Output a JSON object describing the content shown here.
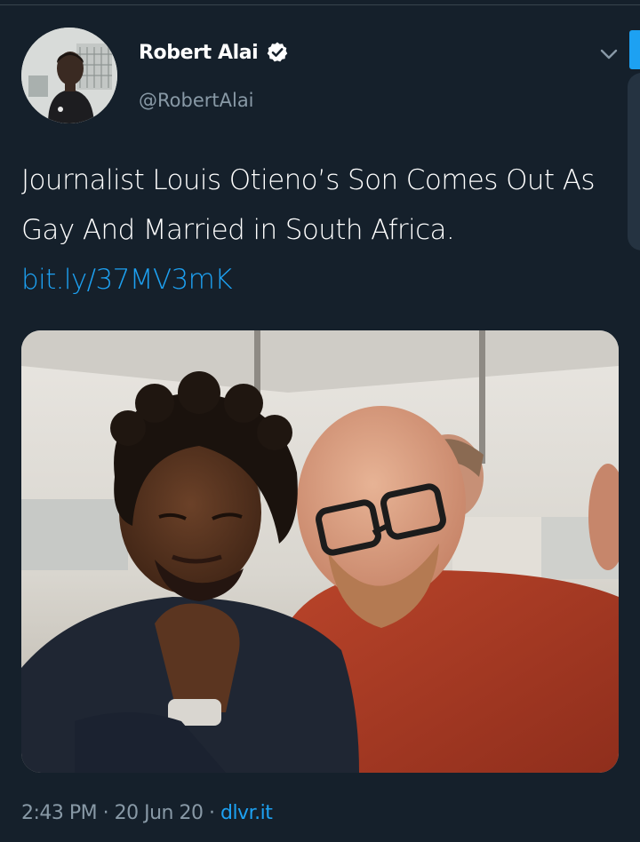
{
  "tweet": {
    "author": {
      "display_name": "Robert Alai",
      "handle": "@RobertAlai",
      "verified": true
    },
    "text": "Journalist Louis Otieno’s Son Comes Out As Gay And Married in South Africa. ",
    "link": "bit.ly/37MV3mK",
    "media_icon": "photo",
    "meta": {
      "time": "2:43 PM",
      "separator": " · ",
      "date": "20 Jun 20",
      "source": "dlvr.it"
    }
  },
  "icons": {
    "verified": "verified-badge-icon",
    "more": "chevron-down-icon"
  },
  "colors": {
    "background": "#15202b",
    "text": "#ffffff",
    "secondary": "#8899a6",
    "accent": "#1da1f2"
  }
}
